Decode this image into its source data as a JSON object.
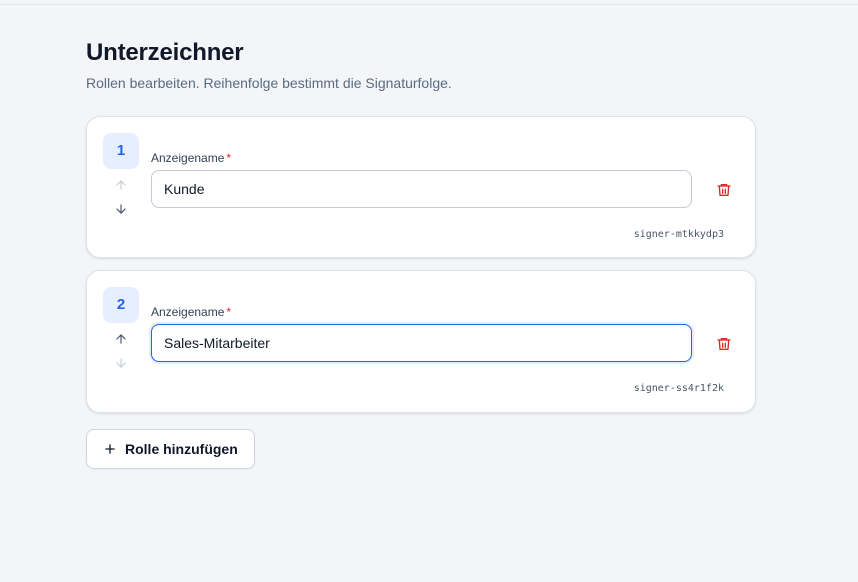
{
  "header": {
    "title": "Unterzeichner",
    "subtitle": "Rollen bearbeiten. Reihenfolge bestimmt die Signaturfolge."
  },
  "signers": [
    {
      "number": "1",
      "field_label": "Anzeigename",
      "required_mark": "*",
      "display_name": "Kunde",
      "id": "signer-mtkkydp3",
      "move_up_enabled": false,
      "move_down_enabled": true
    },
    {
      "number": "2",
      "field_label": "Anzeigename",
      "required_mark": "*",
      "display_name": "Sales-Mitarbeiter",
      "id": "signer-ss4r1f2k",
      "move_up_enabled": true,
      "move_down_enabled": false
    }
  ],
  "actions": {
    "add_role_label": "Rolle hinzufügen"
  },
  "icons": {
    "move_up": "arrow-up-icon",
    "move_down": "arrow-down-icon",
    "delete": "trash-icon",
    "add": "plus-icon"
  },
  "colors": {
    "accent": "#2563eb",
    "danger": "#dc2626",
    "badge_bg": "#e5efff"
  }
}
